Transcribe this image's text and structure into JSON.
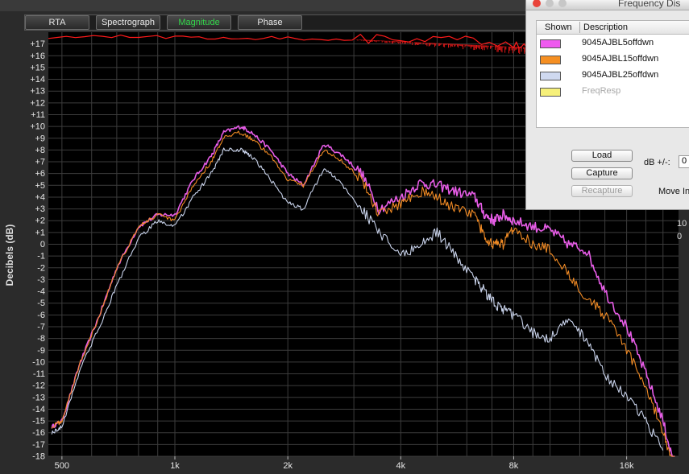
{
  "tabs": [
    {
      "label": "RTA",
      "active": false
    },
    {
      "label": "Spectrograph",
      "active": false
    },
    {
      "label": "Magnitude",
      "active": true
    },
    {
      "label": "Phase",
      "active": false
    }
  ],
  "axis": {
    "y_label": "Decibels (dB)",
    "y_ticks": [
      "+17",
      "+16",
      "+15",
      "+14",
      "+13",
      "+12",
      "+11",
      "+10",
      "+9",
      "+8",
      "+7",
      "+6",
      "+5",
      "+4",
      "+3",
      "+2",
      "+1",
      "0",
      "-1",
      "-2",
      "-3",
      "-4",
      "-5",
      "-6",
      "-7",
      "-8",
      "-9",
      "-10",
      "-11",
      "-12",
      "-13",
      "-14",
      "-15",
      "-16",
      "-17",
      "-18"
    ],
    "x_ticks": [
      "500",
      "1k",
      "2k",
      "4k",
      "8k",
      "16k"
    ]
  },
  "colors": {
    "curve1": "#e65ce6",
    "curve2": "#f08a24",
    "curve3": "#c8d2ea",
    "reference": "#ff1a1a",
    "plot_bg": "#000000",
    "grid": "#3c3c3c"
  },
  "chart_data": {
    "type": "line",
    "title": "",
    "xlabel": "",
    "ylabel": "Decibels (dB)",
    "x_scale": "log",
    "xlim": [
      460,
      22000
    ],
    "ylim": [
      -18,
      18
    ],
    "grid": true,
    "series": [
      {
        "name": "9045AJBL5offdwn",
        "color": "#e65ce6",
        "x": [
          470,
          500,
          560,
          630,
          700,
          800,
          900,
          1000,
          1120,
          1250,
          1350,
          1500,
          1600,
          1800,
          2000,
          2200,
          2500,
          2800,
          3150,
          3500,
          4000,
          4500,
          5000,
          5600,
          6300,
          6700,
          7100,
          7500,
          8000,
          9000,
          10000,
          11200,
          12500,
          14000,
          16000,
          18000,
          20000,
          21500
        ],
        "y": [
          -15.5,
          -15,
          -10,
          -6,
          -2,
          1.5,
          2.5,
          2.5,
          5.5,
          7.5,
          9.5,
          10,
          9.5,
          8,
          6,
          5,
          8.5,
          7.5,
          6,
          3,
          4,
          5.2,
          5,
          4.5,
          4,
          2.5,
          2,
          2.5,
          2,
          1.5,
          1.2,
          0,
          -0.5,
          -4,
          -7,
          -11,
          -15,
          -19
        ]
      },
      {
        "name": "9045AJBL15offdwn",
        "color": "#f08a24",
        "x": [
          470,
          500,
          560,
          630,
          700,
          800,
          900,
          1000,
          1120,
          1250,
          1350,
          1500,
          1600,
          1800,
          2000,
          2200,
          2500,
          2800,
          3150,
          3500,
          4000,
          4500,
          5000,
          5600,
          6300,
          6700,
          7100,
          7500,
          8000,
          9000,
          10000,
          11200,
          12500,
          14000,
          16000,
          18000,
          20000,
          21500
        ],
        "y": [
          -15.5,
          -15,
          -10,
          -6,
          -2,
          1.5,
          2.5,
          2,
          5,
          7,
          9,
          9.5,
          9,
          7.5,
          5.5,
          5,
          8,
          7,
          5.5,
          2.5,
          3.5,
          4.5,
          4,
          3,
          2.5,
          0.5,
          0,
          0,
          1.5,
          0,
          -0.5,
          -2.5,
          -4.5,
          -6,
          -9,
          -12,
          -16,
          -19
        ]
      },
      {
        "name": "9045AJBL25offdwn",
        "color": "#c8d2ea",
        "x": [
          470,
          500,
          560,
          630,
          700,
          800,
          900,
          1000,
          1120,
          1250,
          1350,
          1500,
          1600,
          1800,
          2000,
          2200,
          2500,
          2800,
          3150,
          3500,
          4000,
          4500,
          5000,
          5600,
          6300,
          6700,
          7100,
          7500,
          8000,
          9000,
          10000,
          11200,
          12500,
          14000,
          16000,
          18000,
          20000
        ],
        "y": [
          -16,
          -15.5,
          -10.5,
          -7,
          -3.5,
          0.5,
          2,
          1.5,
          4,
          6,
          8,
          8,
          7.5,
          5.5,
          3.5,
          3,
          6.5,
          5,
          3,
          1,
          -1,
          0,
          1,
          -1,
          -3,
          -4,
          -5,
          -5.5,
          -6,
          -7.5,
          -8,
          -6.5,
          -8,
          -11,
          -13,
          -15,
          -17.5
        ]
      },
      {
        "name": "FreqResp",
        "color": "#ff1a1a",
        "shown": false,
        "x": [
          460,
          1000,
          2000,
          4000,
          8000,
          10000,
          12000,
          16000,
          21500
        ],
        "y": [
          17.6,
          17.6,
          17.5,
          17.4,
          17.1,
          16.9,
          16.6,
          16.3,
          16.1
        ]
      }
    ]
  },
  "dialog": {
    "title": "Frequency Dis",
    "col_shown": "Shown",
    "col_desc": "Description",
    "items": [
      {
        "label": "9045AJBL5offdwn",
        "color": "#ef5aef",
        "dim": false
      },
      {
        "label": "9045AJBL15offdwn",
        "color": "#f58f22",
        "dim": false
      },
      {
        "label": "9045AJBL25offdwn",
        "color": "#cfd9f0",
        "dim": false
      },
      {
        "label": "FreqResp",
        "color": "#f6f07a",
        "dim": true
      }
    ],
    "load": "Load",
    "capture": "Capture",
    "recapture": "Recapture",
    "db_label": "dB +/-:",
    "db_value": "0",
    "move_label": "Move In"
  },
  "peek": {
    "label_a": "10",
    "label_b": "0"
  }
}
